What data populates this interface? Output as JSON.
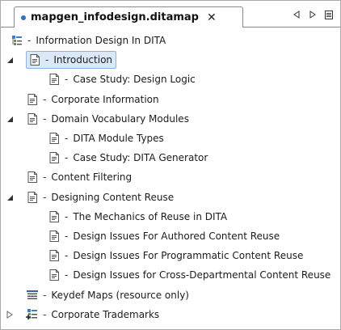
{
  "tab": {
    "title": "mapgen_infodesign.ditamap",
    "close_glyph": "✕",
    "dirty_indicator_color": "#3a6fb7"
  },
  "toolbar": {
    "icons": [
      "triangle-left-icon",
      "triangle-right-icon",
      "menu-icon"
    ]
  },
  "tree": {
    "dash": "-",
    "items": [
      {
        "label": "Information Design In DITA",
        "icon": "map-icon",
        "level": 0,
        "toggle": "none"
      },
      {
        "label": "Introduction",
        "icon": "topic-icon",
        "level": 1,
        "toggle": "expanded",
        "selected": true
      },
      {
        "label": "Case Study: Design Logic",
        "icon": "topic-icon",
        "level": 2,
        "toggle": "none"
      },
      {
        "label": "Corporate Information",
        "icon": "topic-icon",
        "level": 1,
        "toggle": "none"
      },
      {
        "label": "Domain Vocabulary Modules",
        "icon": "topic-icon",
        "level": 1,
        "toggle": "expanded"
      },
      {
        "label": "DITA Module Types",
        "icon": "topic-icon",
        "level": 2,
        "toggle": "none"
      },
      {
        "label": "Case Study: DITA Generator",
        "icon": "topic-icon",
        "level": 2,
        "toggle": "none"
      },
      {
        "label": "Content Filtering",
        "icon": "topic-icon",
        "level": 1,
        "toggle": "none"
      },
      {
        "label": "Designing Content Reuse",
        "icon": "topic-icon",
        "level": 1,
        "toggle": "expanded"
      },
      {
        "label": "The Mechanics of Reuse in DITA",
        "icon": "topic-icon",
        "level": 2,
        "toggle": "none"
      },
      {
        "label": "Design Issues For Authored Content Reuse",
        "icon": "topic-icon",
        "level": 2,
        "toggle": "none"
      },
      {
        "label": "Design Issues For Programmatic Content Reuse",
        "icon": "topic-icon",
        "level": 2,
        "toggle": "none"
      },
      {
        "label": "Design Issues for Cross-Departmental Content Reuse",
        "icon": "topic-icon",
        "level": 2,
        "toggle": "none"
      },
      {
        "label": "Keydef Maps (resource only)",
        "icon": "keydef-icon",
        "level": 1,
        "toggle": "none"
      },
      {
        "label": "Corporate Trademarks",
        "icon": "submap-icon",
        "level": 1,
        "toggle": "collapsed"
      }
    ]
  }
}
